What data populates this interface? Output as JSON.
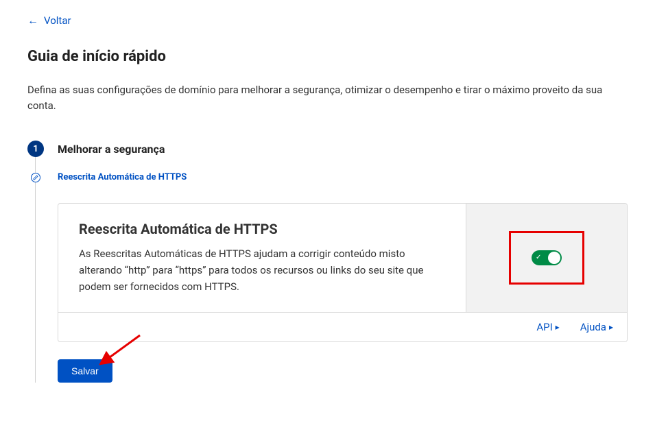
{
  "back": {
    "label": "Voltar"
  },
  "page": {
    "title": "Guia de início rápido",
    "description": "Defina as suas configurações de domínio para melhorar a segurança, otimizar o desempenho e tirar o máximo proveito da sua conta."
  },
  "step": {
    "number": "1",
    "title": "Melhorar a segurança",
    "substep_label": "Reescrita Automática de HTTPS"
  },
  "card": {
    "title": "Reescrita Automática de HTTPS",
    "description": "As Reescritas Automáticas de HTTPS ajudam a corrigir conteúdo misto alterando “http” para “https” para todos os recursos ou links do seu site que podem ser fornecidos com HTTPS.",
    "footer": {
      "api_label": "API",
      "help_label": "Ajuda"
    }
  },
  "actions": {
    "save_label": "Salvar"
  }
}
